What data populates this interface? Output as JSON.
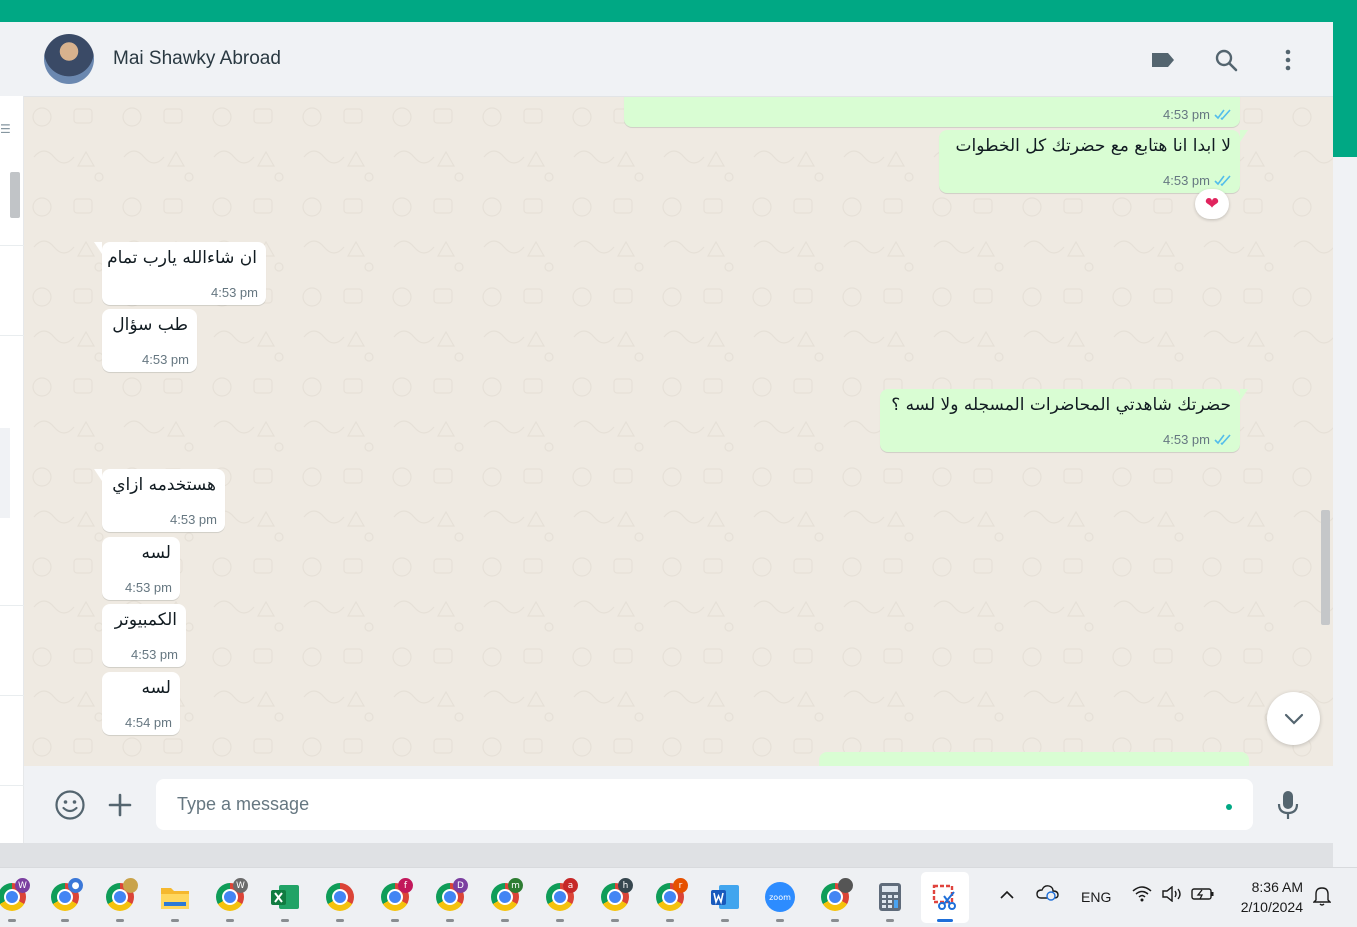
{
  "colors": {
    "accent": "#00a884",
    "outgoing_bubble": "#d9fdd3",
    "incoming_bubble": "#ffffff",
    "chat_bg": "#efeae2",
    "tick_read": "#53bdeb"
  },
  "header": {
    "contact_name": "Mai Shawky Abroad",
    "icons": [
      "label-icon",
      "search-icon",
      "menu-icon"
    ]
  },
  "messages": [
    {
      "dir": "out",
      "text": "",
      "time": "4:53 pm",
      "status": "read"
    },
    {
      "dir": "out",
      "text": "لا ابدا انا هتابع مع حضرتك كل الخطوات",
      "time": "4:53 pm",
      "status": "read",
      "reaction": "❤"
    },
    {
      "dir": "in",
      "text": "ان شاءالله يارب تمام",
      "time": "4:53 pm"
    },
    {
      "dir": "in",
      "text": "طب سؤال",
      "time": "4:53 pm"
    },
    {
      "dir": "out",
      "text": "حضرتك شاهدتي المحاضرات المسجله ولا لسه ؟",
      "time": "4:53 pm",
      "status": "read"
    },
    {
      "dir": "in",
      "text": "هستخدمه ازاي",
      "time": "4:53 pm"
    },
    {
      "dir": "in",
      "text": "لسه",
      "time": "4:53 pm"
    },
    {
      "dir": "in",
      "text": "الكمبيوتر",
      "time": "4:53 pm"
    },
    {
      "dir": "in",
      "text": "لسه",
      "time": "4:54 pm"
    }
  ],
  "composer": {
    "placeholder": "Type a message",
    "value": "",
    "icons": [
      "emoji-icon",
      "attach-plus-icon",
      "microphone-icon"
    ]
  },
  "taskbar": {
    "apps": [
      {
        "name": "chrome-profile-w",
        "badge": "W",
        "badge_color": "#7b3fa0"
      },
      {
        "name": "chrome-profile-person",
        "badge": "",
        "badge_color": "#3b78d8"
      },
      {
        "name": "chrome-profile-photo",
        "badge": "",
        "badge_color": "#c9a34a"
      },
      {
        "name": "file-explorer",
        "badge": "",
        "badge_color": ""
      },
      {
        "name": "chrome-profile-w2",
        "badge": "W",
        "badge_color": "#6b6b6b"
      },
      {
        "name": "excel",
        "badge": "",
        "badge_color": ""
      },
      {
        "name": "chrome",
        "badge": "",
        "badge_color": ""
      },
      {
        "name": "chrome-profile-f",
        "badge": "f",
        "badge_color": "#c2185b"
      },
      {
        "name": "chrome-profile-d",
        "badge": "D",
        "badge_color": "#7b3fa0"
      },
      {
        "name": "chrome-profile-m",
        "badge": "m",
        "badge_color": "#2e7d32"
      },
      {
        "name": "chrome-profile-a",
        "badge": "a",
        "badge_color": "#c62828"
      },
      {
        "name": "chrome-profile-h",
        "badge": "h",
        "badge_color": "#37474f"
      },
      {
        "name": "chrome-profile-r",
        "badge": "r",
        "badge_color": "#e65100"
      },
      {
        "name": "word",
        "badge": "",
        "badge_color": ""
      },
      {
        "name": "zoom",
        "badge": "",
        "badge_color": ""
      },
      {
        "name": "chrome-profile-photo2",
        "badge": "",
        "badge_color": "#555555"
      },
      {
        "name": "calculator",
        "badge": "",
        "badge_color": ""
      },
      {
        "name": "snipping-tool",
        "badge": "",
        "badge_color": ""
      }
    ],
    "zoom_label": "zoom",
    "language": "ENG",
    "time": "8:36 AM",
    "date": "2/10/2024"
  }
}
